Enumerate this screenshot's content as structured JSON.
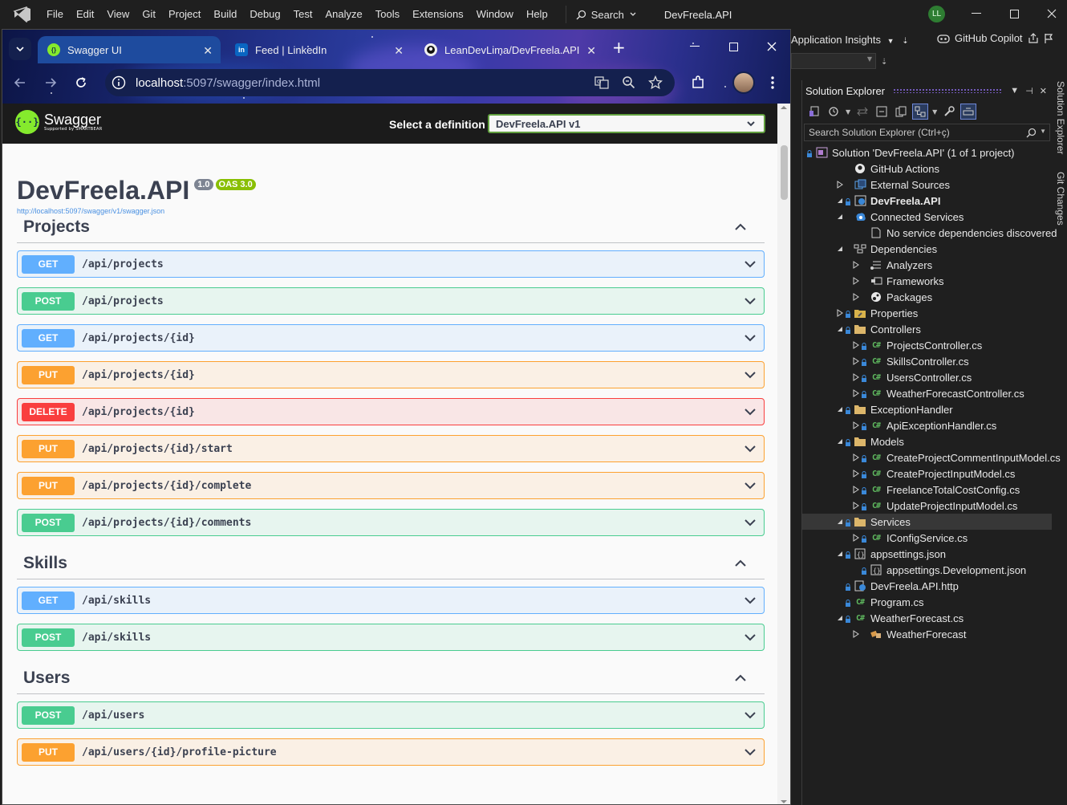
{
  "vs": {
    "menu": [
      "File",
      "Edit",
      "View",
      "Git",
      "Project",
      "Build",
      "Debug",
      "Test",
      "Analyze",
      "Tools",
      "Extensions",
      "Window",
      "Help"
    ],
    "search_label": "Search",
    "title": "DevFreela.API",
    "user_initials": "LL",
    "app_insights": "Application Insights",
    "copilot": "GitHub Copilot"
  },
  "browser": {
    "tabs": [
      {
        "title": "Swagger UI",
        "active": true
      },
      {
        "title": "Feed | LinkedIn",
        "active": false
      },
      {
        "title": "LeanDevLima/DevFreela.API",
        "active": false
      }
    ],
    "url_host": "localhost",
    "url_path": ":5097/swagger/index.html"
  },
  "swagger": {
    "logo_title": "Swagger",
    "logo_sub": "Supported by SMARTBEAR",
    "definition_label": "Select a definition",
    "definition_value": "DevFreela.API v1",
    "api_title": "DevFreela.API",
    "version_badge": "1.0",
    "oas_badge": "OAS 3.0",
    "spec_link": "http://localhost:5097/swagger/v1/swagger.json",
    "tags": [
      {
        "name": "Projects",
        "operations": [
          {
            "method": "GET",
            "path": "/api/projects"
          },
          {
            "method": "POST",
            "path": "/api/projects"
          },
          {
            "method": "GET",
            "path": "/api/projects/{id}"
          },
          {
            "method": "PUT",
            "path": "/api/projects/{id}"
          },
          {
            "method": "DELETE",
            "path": "/api/projects/{id}"
          },
          {
            "method": "PUT",
            "path": "/api/projects/{id}/start"
          },
          {
            "method": "PUT",
            "path": "/api/projects/{id}/complete"
          },
          {
            "method": "POST",
            "path": "/api/projects/{id}/comments"
          }
        ]
      },
      {
        "name": "Skills",
        "operations": [
          {
            "method": "GET",
            "path": "/api/skills"
          },
          {
            "method": "POST",
            "path": "/api/skills"
          }
        ]
      },
      {
        "name": "Users",
        "operations": [
          {
            "method": "POST",
            "path": "/api/users"
          },
          {
            "method": "PUT",
            "path": "/api/users/{id}/profile-picture"
          }
        ]
      }
    ]
  },
  "solution_explorer": {
    "title": "Solution Explorer",
    "search_placeholder": "Search Solution Explorer (Ctrl+ç)",
    "side_tabs": [
      "Solution Explorer",
      "Git Changes"
    ],
    "items": [
      {
        "label": "Solution 'DevFreela.API' (1 of 1 project)",
        "icon": "solution-icon",
        "level": 0,
        "expander": "none",
        "lock": true,
        "selected": false,
        "bold": false
      },
      {
        "label": "GitHub Actions",
        "icon": "github-icon",
        "level": 1,
        "expander": "none",
        "lock": false,
        "selected": false,
        "bold": false
      },
      {
        "label": "External Sources",
        "icon": "external-sources-icon",
        "level": 1,
        "expander": "collapsed",
        "lock": false,
        "selected": false,
        "bold": false
      },
      {
        "label": "DevFreela.API",
        "icon": "web-project-icon",
        "level": 1,
        "expander": "expanded",
        "lock": true,
        "selected": false,
        "bold": true
      },
      {
        "label": "Connected Services",
        "icon": "connected-services-icon",
        "level": 2,
        "expander": "expanded",
        "lock": false,
        "selected": false,
        "bold": false
      },
      {
        "label": "No service dependencies discovered",
        "icon": "file-icon",
        "level": 3,
        "expander": "none",
        "lock": false,
        "selected": false,
        "bold": false
      },
      {
        "label": "Dependencies",
        "icon": "dependencies-icon",
        "level": 2,
        "expander": "expanded",
        "lock": false,
        "selected": false,
        "bold": false
      },
      {
        "label": "Analyzers",
        "icon": "analyzers-icon",
        "level": 3,
        "expander": "collapsed",
        "lock": false,
        "selected": false,
        "bold": false
      },
      {
        "label": "Frameworks",
        "icon": "frameworks-icon",
        "level": 3,
        "expander": "collapsed",
        "lock": false,
        "selected": false,
        "bold": false
      },
      {
        "label": "Packages",
        "icon": "packages-icon",
        "level": 3,
        "expander": "collapsed",
        "lock": false,
        "selected": false,
        "bold": false
      },
      {
        "label": "Properties",
        "icon": "properties-icon",
        "level": 2,
        "expander": "collapsed",
        "lock": true,
        "selected": false,
        "bold": false
      },
      {
        "label": "Controllers",
        "icon": "folder-icon",
        "level": 2,
        "expander": "expanded",
        "lock": true,
        "selected": false,
        "bold": false
      },
      {
        "label": "ProjectsController.cs",
        "icon": "csharp-icon",
        "level": 3,
        "expander": "collapsed",
        "lock": true,
        "selected": false,
        "bold": false
      },
      {
        "label": "SkillsController.cs",
        "icon": "csharp-icon",
        "level": 3,
        "expander": "collapsed",
        "lock": true,
        "selected": false,
        "bold": false
      },
      {
        "label": "UsersController.cs",
        "icon": "csharp-icon",
        "level": 3,
        "expander": "collapsed",
        "lock": true,
        "selected": false,
        "bold": false
      },
      {
        "label": "WeatherForecastController.cs",
        "icon": "csharp-icon",
        "level": 3,
        "expander": "collapsed",
        "lock": true,
        "selected": false,
        "bold": false
      },
      {
        "label": "ExceptionHandler",
        "icon": "folder-icon",
        "level": 2,
        "expander": "expanded",
        "lock": true,
        "selected": false,
        "bold": false
      },
      {
        "label": "ApiExceptionHandler.cs",
        "icon": "csharp-icon",
        "level": 3,
        "expander": "collapsed",
        "lock": true,
        "selected": false,
        "bold": false
      },
      {
        "label": "Models",
        "icon": "folder-icon",
        "level": 2,
        "expander": "expanded",
        "lock": true,
        "selected": false,
        "bold": false
      },
      {
        "label": "CreateProjectCommentInputModel.cs",
        "icon": "csharp-icon",
        "level": 3,
        "expander": "collapsed",
        "lock": true,
        "selected": false,
        "bold": false
      },
      {
        "label": "CreateProjectInputModel.cs",
        "icon": "csharp-icon",
        "level": 3,
        "expander": "collapsed",
        "lock": true,
        "selected": false,
        "bold": false
      },
      {
        "label": "FreelanceTotalCostConfig.cs",
        "icon": "csharp-icon",
        "level": 3,
        "expander": "collapsed",
        "lock": true,
        "selected": false,
        "bold": false
      },
      {
        "label": "UpdateProjectInputModel.cs",
        "icon": "csharp-icon",
        "level": 3,
        "expander": "collapsed",
        "lock": true,
        "selected": false,
        "bold": false
      },
      {
        "label": "Services",
        "icon": "folder-icon",
        "level": 2,
        "expander": "expanded",
        "lock": true,
        "selected": true,
        "bold": false
      },
      {
        "label": "IConfigService.cs",
        "icon": "csharp-icon",
        "level": 3,
        "expander": "collapsed",
        "lock": true,
        "selected": false,
        "bold": false
      },
      {
        "label": "appsettings.json",
        "icon": "json-icon",
        "level": 2,
        "expander": "expanded",
        "lock": true,
        "selected": false,
        "bold": false
      },
      {
        "label": "appsettings.Development.json",
        "icon": "json-icon",
        "level": 3,
        "expander": "none",
        "lock": true,
        "selected": false,
        "bold": false
      },
      {
        "label": "DevFreela.API.http",
        "icon": "http-file-icon",
        "level": 2,
        "expander": "none",
        "lock": true,
        "selected": false,
        "bold": false
      },
      {
        "label": "Program.cs",
        "icon": "csharp-icon",
        "level": 2,
        "expander": "none",
        "lock": true,
        "selected": false,
        "bold": false
      },
      {
        "label": "WeatherForecast.cs",
        "icon": "csharp-icon",
        "level": 2,
        "expander": "expanded",
        "lock": true,
        "selected": false,
        "bold": false
      },
      {
        "label": "WeatherForecast",
        "icon": "class-icon",
        "level": 3,
        "expander": "collapsed",
        "lock": false,
        "selected": false,
        "bold": false
      }
    ]
  }
}
